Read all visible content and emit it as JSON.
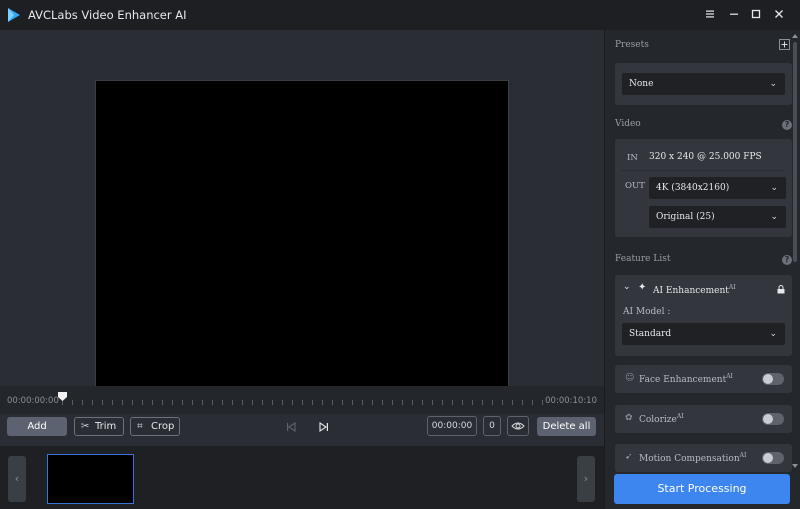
{
  "app": {
    "title": "AVCLabs Video Enhancer AI",
    "accent": "#3d86f0"
  },
  "window_controls": [
    "menu-icon",
    "minimize-icon",
    "maximize-icon",
    "close-icon"
  ],
  "timeline": {
    "start_time": "00:00:00:00",
    "end_time": "00:00:10:10"
  },
  "controls": {
    "add_label": "Add",
    "trim_label": "Trim",
    "crop_label": "Crop",
    "time_value": "00:00:00",
    "frame_value": "0",
    "delete_all_label": "Delete all"
  },
  "right_panel": {
    "presets_label": "Presets",
    "preset_value": "None",
    "video_label": "Video",
    "in_label": "IN",
    "in_value": "320 x 240 @ 25.000 FPS",
    "out_label": "OUT",
    "resolution_value": "4K (3840x2160)",
    "framerate_value": "Original (25)",
    "feature_list_label": "Feature List",
    "ai_enhancement_label": "AI Enhancement",
    "ai_sup": "AI",
    "ai_model_label": "AI Model :",
    "ai_model_value": "Standard",
    "face_enhancement_label": "Face Enhancement",
    "colorize_label": "Colorize",
    "motion_compensation_label": "Motion Compensation",
    "start_button_label": "Start Processing"
  }
}
